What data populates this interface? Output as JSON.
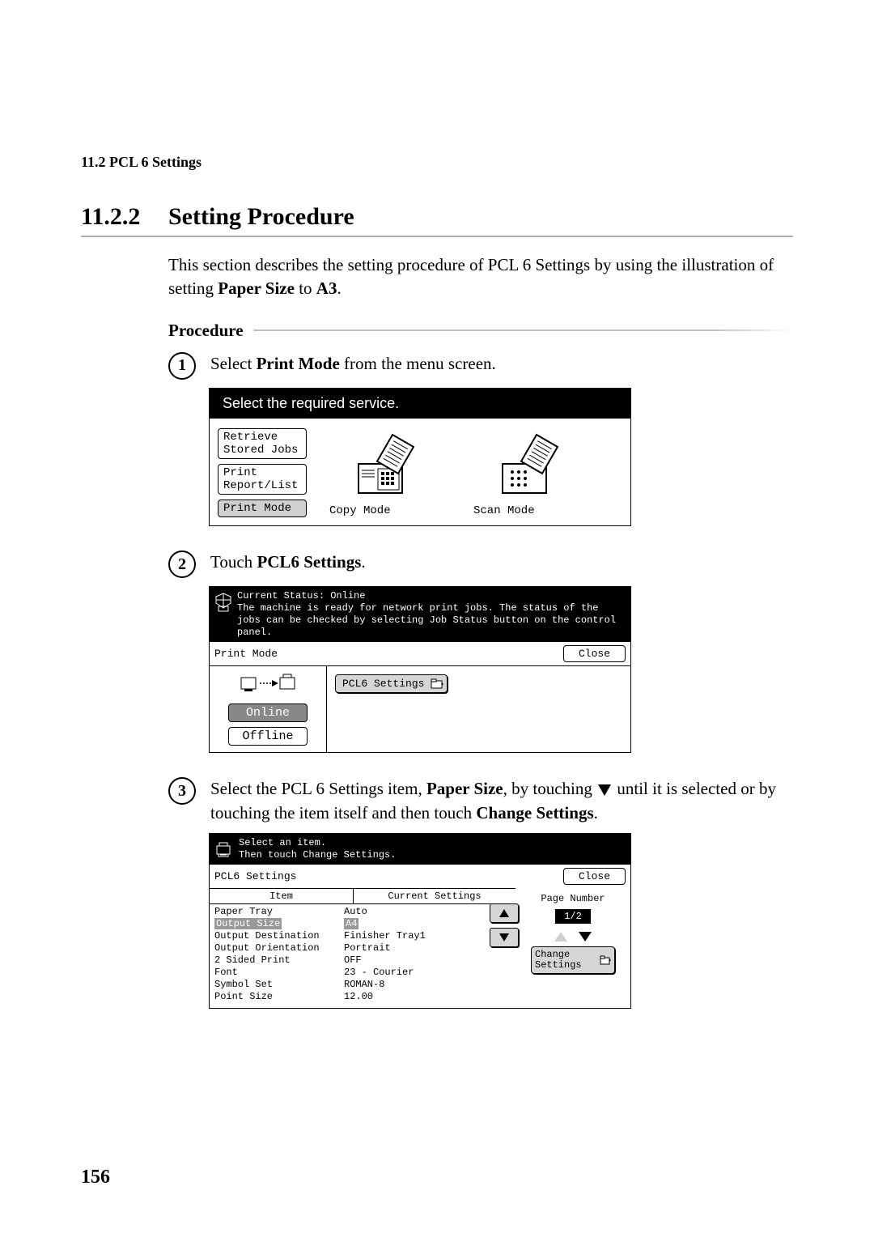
{
  "header_path": "11.2 PCL 6 Settings",
  "section": {
    "number": "11.2.2",
    "title": "Setting Procedure"
  },
  "intro": {
    "pre": "This section describes the setting procedure of PCL 6 Settings by using the illustration of setting ",
    "b1": "Paper Size",
    "mid": " to ",
    "b2": "A3",
    "post": "."
  },
  "procedure_label": "Procedure",
  "steps": [
    {
      "num": "1",
      "pre": "Select ",
      "b1": "Print Mode",
      "post": " from the menu screen."
    },
    {
      "num": "2",
      "pre": "Touch ",
      "b1": "PCL6 Settings",
      "post": "."
    },
    {
      "num": "3",
      "pre": "Select the PCL 6 Settings item, ",
      "b1": "Paper Size",
      "mid": ", by touching ",
      "post_tri": " until it is selected or by touching the item itself and then touch ",
      "b2": "Change Settings",
      "post": "."
    }
  ],
  "panel1": {
    "title": "Select the required service.",
    "buttons": {
      "retrieve": "Retrieve\nStored Jobs",
      "report": "Print\nReport/List",
      "printmode": "Print Mode"
    },
    "modes": {
      "copy": "Copy Mode",
      "scan": "Scan Mode"
    }
  },
  "panel2": {
    "status_title": "Current Status: Online",
    "status_body": "The machine is ready for network print jobs.  The status of the jobs can be checked by selecting Job Status button on the control panel.",
    "bar_label": "Print Mode",
    "close": "Close",
    "online": "Online",
    "offline": "Offline",
    "pcl6": "PCL6 Settings"
  },
  "panel3": {
    "hline1": "Select an item.",
    "hline2": "Then touch Change Settings.",
    "bar_label": "PCL6 Settings",
    "close": "Close",
    "col_item": "Item",
    "col_current": "Current Settings",
    "rows": [
      {
        "item": "Paper Tray",
        "val": "Auto"
      },
      {
        "item": "Output Size",
        "val": "A4",
        "highlight": true
      },
      {
        "item": "Output Destination",
        "val": "Finisher Tray1"
      },
      {
        "item": "Output Orientation",
        "val": "Portrait"
      },
      {
        "item": "2 Sided Print",
        "val": "OFF"
      },
      {
        "item": "Font",
        "val": "23 - Courier"
      },
      {
        "item": "Symbol Set",
        "val": "ROMAN-8"
      },
      {
        "item": "Point Size",
        "val": "12.00"
      }
    ],
    "page_number_label": "Page Number",
    "page_number_value": "1/2",
    "change_settings": "Change\nSettings"
  },
  "page_number": "156"
}
